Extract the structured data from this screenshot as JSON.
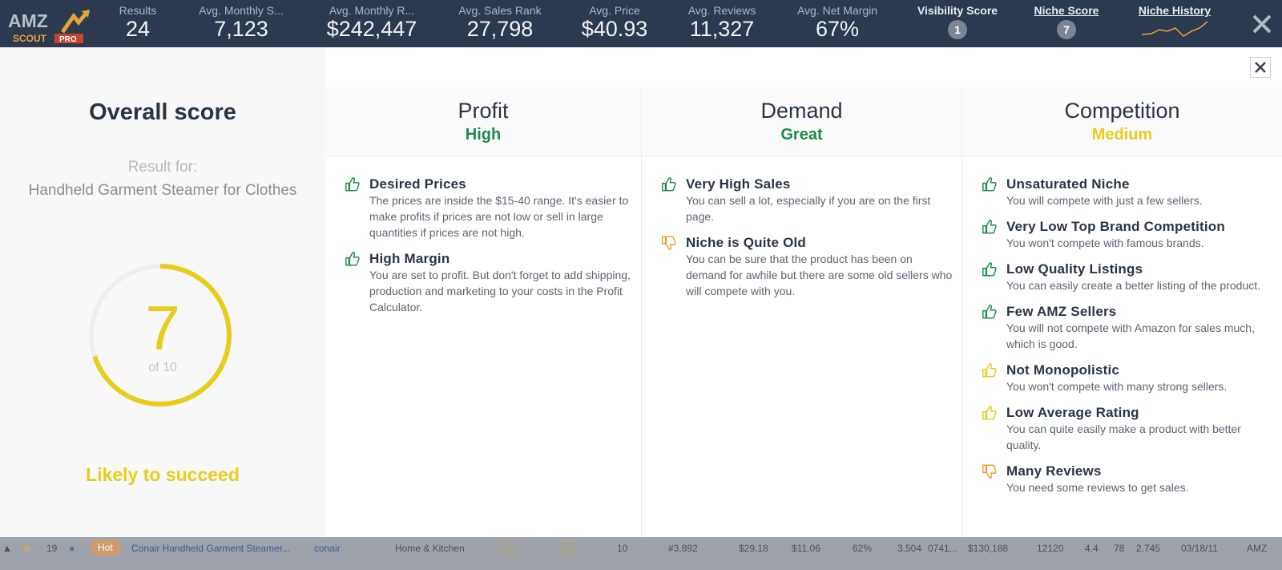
{
  "topbar": {
    "logo": {
      "amz": "AMZ",
      "scout": "SCOUT",
      "pro": "PRO"
    },
    "stats": [
      {
        "label": "Results",
        "value": "24"
      },
      {
        "label": "Avg. Monthly S...",
        "value": "7,123"
      },
      {
        "label": "Avg. Monthly R...",
        "value": "$242,447"
      },
      {
        "label": "Avg. Sales Rank",
        "value": "27,798"
      },
      {
        "label": "Avg. Price",
        "value": "$40.93"
      },
      {
        "label": "Avg. Reviews",
        "value": "11,327"
      },
      {
        "label": "Avg. Net Margin",
        "value": "67%"
      }
    ],
    "visibility": {
      "label": "Visibility Score",
      "value": "1"
    },
    "niche_score": {
      "label": "Niche Score",
      "value": "7"
    },
    "niche_history": {
      "label": "Niche History"
    }
  },
  "left": {
    "title": "Overall score",
    "result_for": "Result for:",
    "product": "Handheld Garment Steamer for Clothes",
    "score": "7",
    "score_of": "of 10",
    "score_fraction": 0.7,
    "verdict": "Likely to succeed"
  },
  "colors": {
    "positive": "#1e8a4c",
    "medium": "#e8cd1c",
    "warning": "#f0a030",
    "dark": "#2a3442"
  },
  "columns": [
    {
      "title": "Profit",
      "rating": "High",
      "rating_color": "#1e8a4c",
      "items": [
        {
          "icon": "thumbs-up-icon",
          "tone": "positive",
          "title": "Desired Prices",
          "desc": "The prices are inside the $15-40 range. It's easier to make profits if prices are not low or sell in large quantities if prices are not high."
        },
        {
          "icon": "thumbs-up-icon",
          "tone": "positive",
          "title": "High Margin",
          "desc": "You are set to profit. But don't forget to add shipping, production and marketing to your costs in the Profit Calculator."
        }
      ]
    },
    {
      "title": "Demand",
      "rating": "Great",
      "rating_color": "#1e8a4c",
      "items": [
        {
          "icon": "thumbs-up-icon",
          "tone": "positive",
          "title": "Very High Sales",
          "desc": "You can sell a lot, especially if you are on the first page."
        },
        {
          "icon": "thumbs-down-icon",
          "tone": "warning",
          "title": "Niche is Quite Old",
          "desc": "You can be sure that the product has been on demand for awhile but there are some old sellers who will compete with you."
        }
      ]
    },
    {
      "title": "Competition",
      "rating": "Medium",
      "rating_color": "#e8cd1c",
      "items": [
        {
          "icon": "thumbs-up-icon",
          "tone": "positive",
          "title": "Unsaturated Niche",
          "desc": "You will compete with just a few sellers."
        },
        {
          "icon": "thumbs-up-icon",
          "tone": "positive",
          "title": "Very Low Top Brand Competition",
          "desc": "You won't compete with famous brands."
        },
        {
          "icon": "thumbs-up-icon",
          "tone": "positive",
          "title": "Low Quality Listings",
          "desc": "You can easily create a better listing of the product."
        },
        {
          "icon": "thumbs-up-icon",
          "tone": "positive",
          "title": "Few AMZ Sellers",
          "desc": "You will not compete with Amazon for sales much, which is good."
        },
        {
          "icon": "thumbs-up-icon",
          "tone": "medium",
          "title": "Not Monopolistic",
          "desc": "You won't compete with many strong sellers."
        },
        {
          "icon": "thumbs-up-icon",
          "tone": "medium",
          "title": "Low Average Rating",
          "desc": "You can quite easily make a product with better quality."
        },
        {
          "icon": "thumbs-down-icon",
          "tone": "warning",
          "title": "Many Reviews",
          "desc": "You need some reviews to get sales."
        }
      ]
    }
  ],
  "bottom_row": {
    "index": "19",
    "badge": "Hot",
    "product": "Conair Handheld Garment Steamer...",
    "brand": "conair",
    "category": "Home & Kitchen",
    "c1": "4",
    "c2": "6",
    "c3": "10",
    "rank": "#3,892",
    "price": "$29.18",
    "fees": "$11.06",
    "margin": "62%",
    "sales": "3,504",
    "sales_extra": "0741...",
    "revenue": "$130,188",
    "reviews": "12120",
    "rating": "4.4",
    "lqs": "78",
    "weight": "2.745",
    "date": "03/18/11",
    "seller": "AMZ"
  }
}
